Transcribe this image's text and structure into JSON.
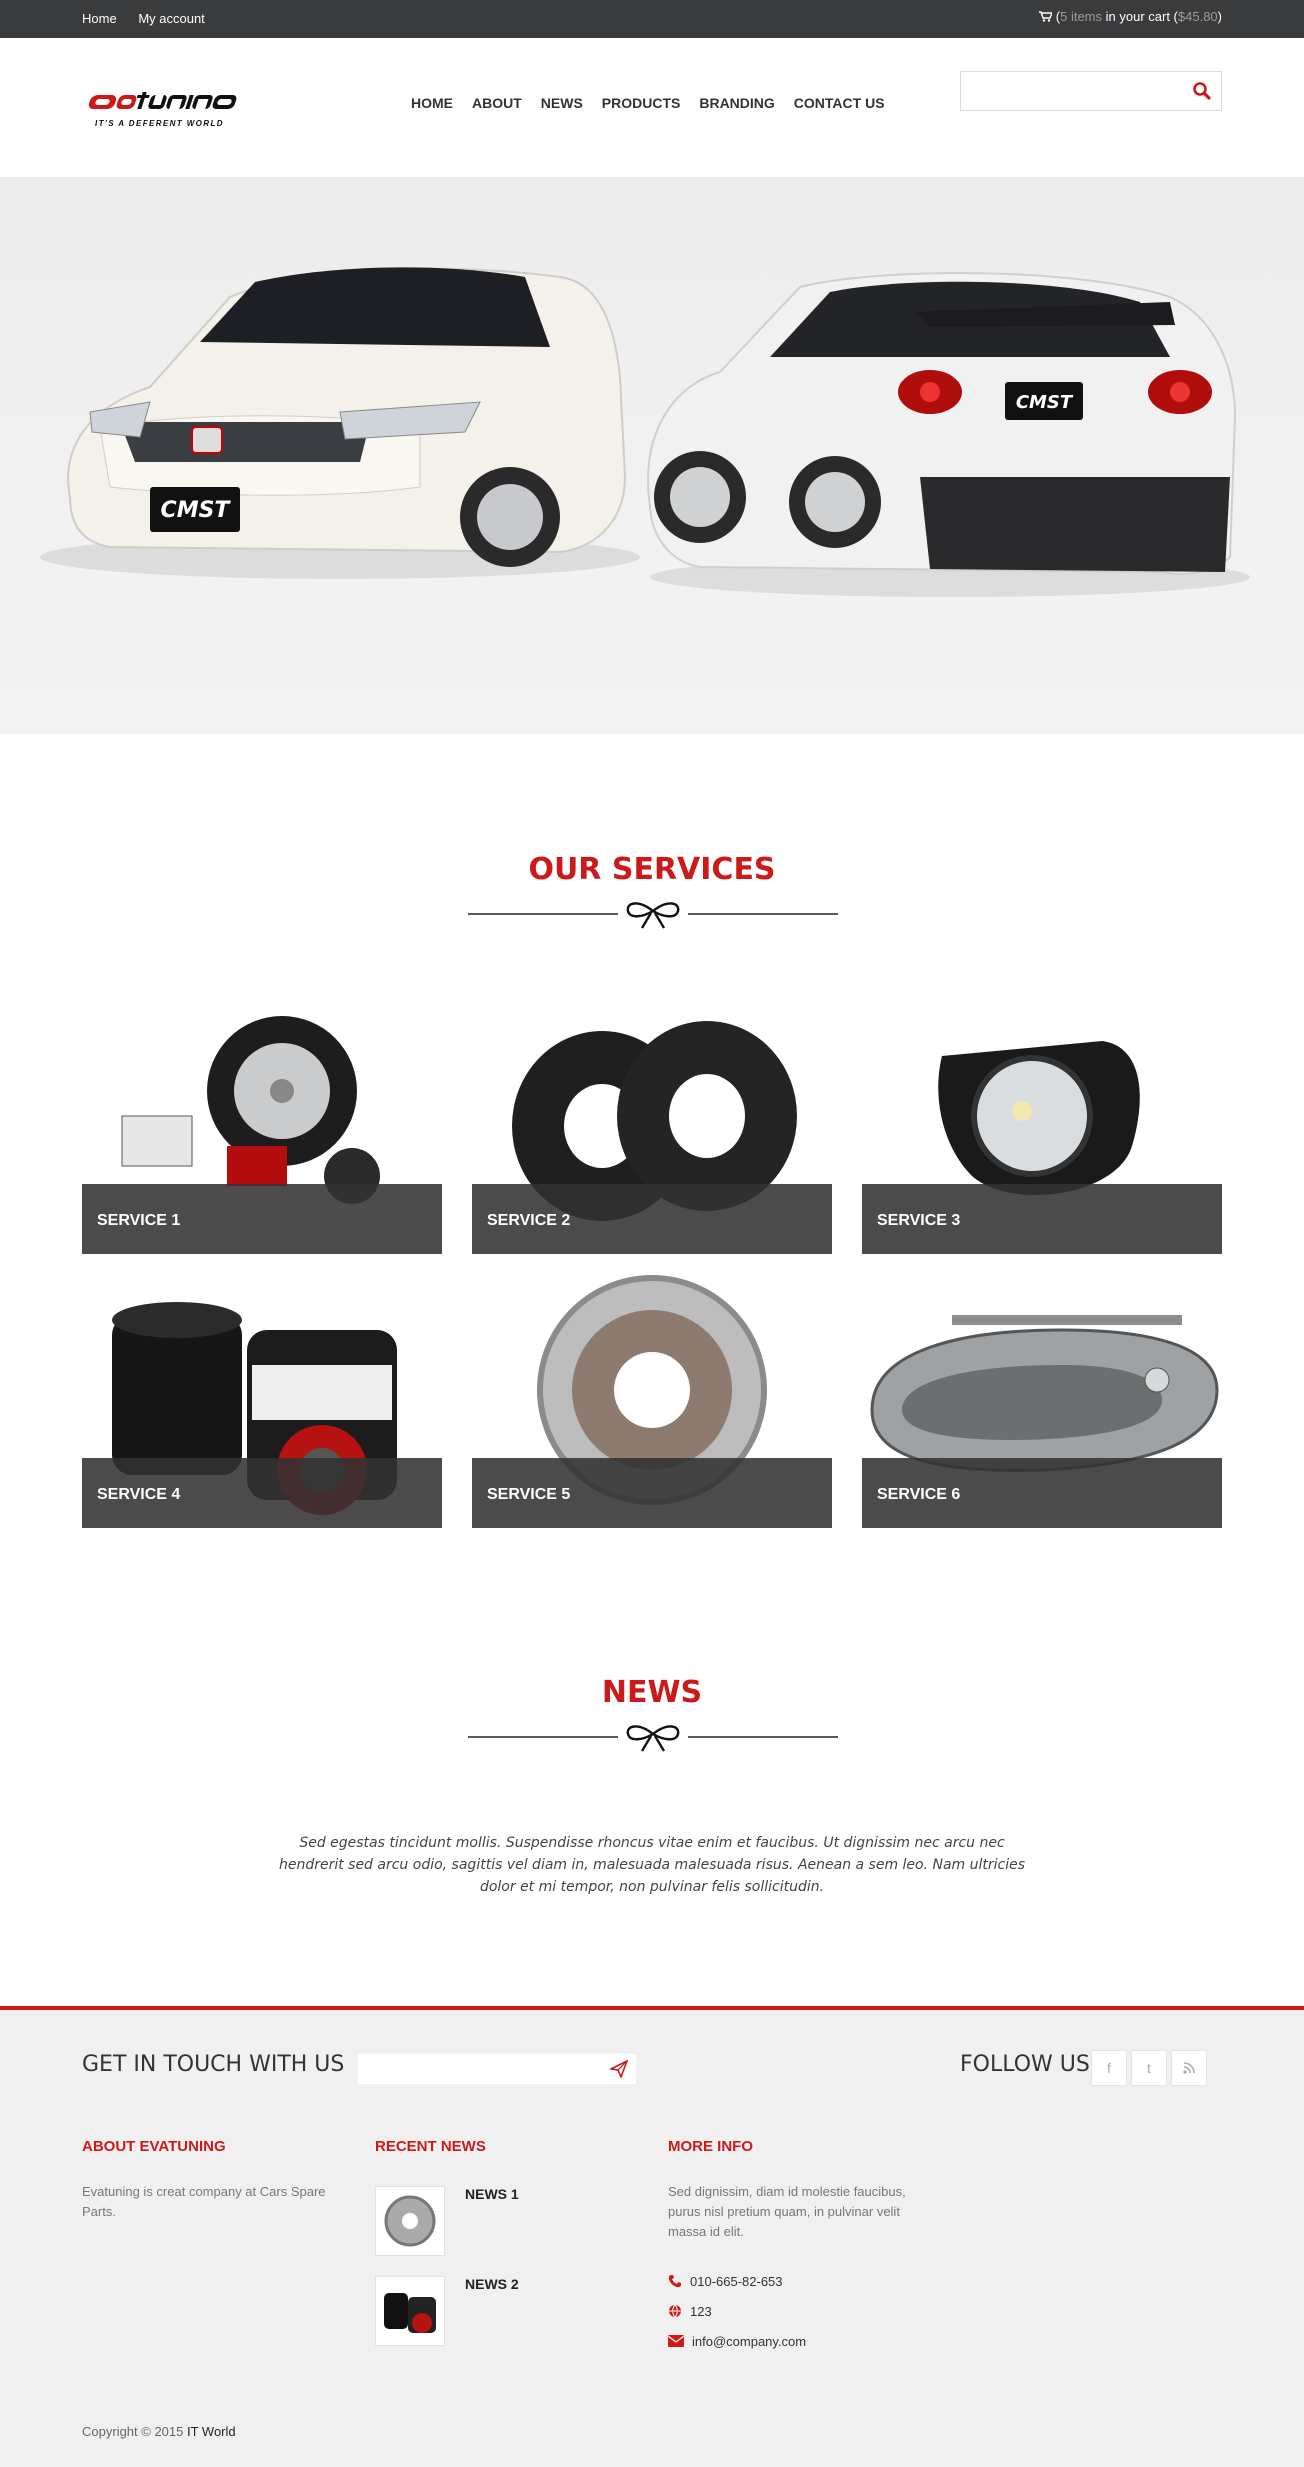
{
  "topbar": {
    "links": [
      "Home",
      "My account"
    ],
    "cart": {
      "icon": "cart-icon",
      "items": "5 items",
      "middle": " in your cart ",
      "total": "$45.80"
    }
  },
  "brand": {
    "name": "eva tuning",
    "tagline": "IT'S A DEFERENT WORLD",
    "accent": "#cc1a1a"
  },
  "nav": [
    "HOME",
    "ABOUT",
    "NEWS",
    "PRODUCTS",
    "BRANDING",
    "CONTACT US"
  ],
  "search": {
    "placeholder": "",
    "icon": "search-icon"
  },
  "hero": {
    "plate_text": "CMST"
  },
  "services": {
    "title": "OUR SERVICES",
    "items": [
      "SERVICE 1",
      "SERVICE 2",
      "SERVICE 3",
      "SERVICE 4",
      "SERVICE 5",
      "SERVICE 6"
    ]
  },
  "news": {
    "title": "NEWS",
    "text": "Sed egestas tincidunt mollis. Suspendisse rhoncus vitae enim et faucibus. Ut dignissim nec arcu nec hendrerit sed arcu odio, sagittis vel diam in, malesuada malesuada risus. Aenean a sem leo. Nam ultricies dolor et mi tempor, non pulvinar felis sollicitudin."
  },
  "footer": {
    "get_in_touch": "GET IN TOUCH WITH US",
    "follow_us": "FOLLOW US:",
    "social": [
      "f",
      "t",
      "rss"
    ],
    "about_title": "ABOUT EVATUNING",
    "about_text": "Evatuning is creat company at Cars Spare Parts.",
    "recent_title": "RECENT NEWS",
    "recent": [
      "NEWS 1",
      "NEWS 2"
    ],
    "more_title": "MORE INFO",
    "more_text": "Sed dignissim, diam id molestie faucibus, purus nisl pretium quam, in pulvinar velit massa id elit.",
    "phone": "010-665-82-653",
    "web": "123",
    "email": "info@company.com",
    "copyright": "Copyright © 2015 ",
    "copyright_owner": "IT World"
  }
}
